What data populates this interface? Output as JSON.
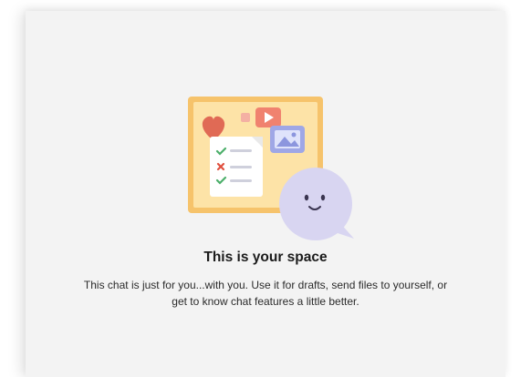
{
  "empty_state": {
    "title": "This is your space",
    "description": "This chat is just for you...with you. Use it for drafts, send files to yourself, or get to know chat features a little better.",
    "illustration_icon": "self-chat-illustration-icon"
  },
  "colors": {
    "panel_background": "#f3f3f3",
    "board_frame": "#f6c36b",
    "board_fill": "#fde3a7",
    "heart": "#e06a55",
    "bubble": "#d8d5f1",
    "check": "#4caf6a",
    "cross": "#e0503f"
  }
}
